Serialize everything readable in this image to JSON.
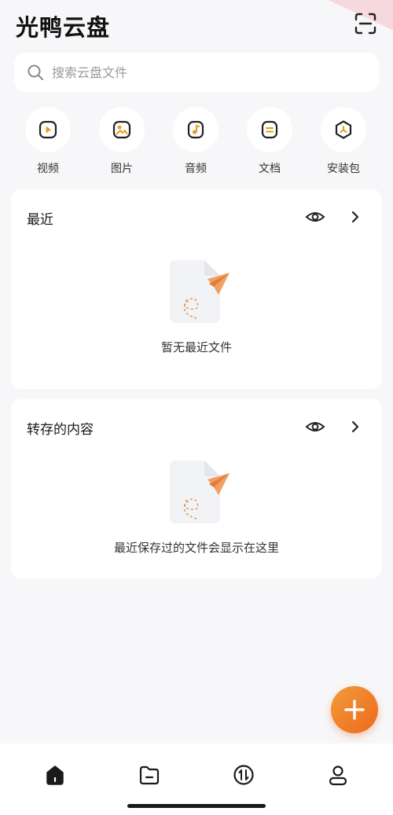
{
  "app": {
    "title": "光鸭云盘"
  },
  "search": {
    "placeholder": "搜索云盘文件",
    "value": ""
  },
  "categories": [
    {
      "label": "视频",
      "icon": "video-icon"
    },
    {
      "label": "图片",
      "icon": "image-icon"
    },
    {
      "label": "音频",
      "icon": "audio-icon"
    },
    {
      "label": "文档",
      "icon": "document-icon"
    },
    {
      "label": "安装包",
      "icon": "package-icon"
    }
  ],
  "recent": {
    "title": "最近",
    "empty_text": "暂无最近文件"
  },
  "saved": {
    "title": "转存的内容",
    "empty_text": "最近保存过的文件会显示在这里"
  },
  "bottom_nav": [
    {
      "name": "home",
      "icon": "home-icon",
      "active": true
    },
    {
      "name": "files",
      "icon": "folder-icon",
      "active": false
    },
    {
      "name": "transfer",
      "icon": "transfer-icon",
      "active": false
    },
    {
      "name": "profile",
      "icon": "user-icon",
      "active": false
    }
  ],
  "colors": {
    "accent": "#ec6a1a",
    "icon_gold": "#e0a020",
    "background": "#f7f7f9"
  }
}
